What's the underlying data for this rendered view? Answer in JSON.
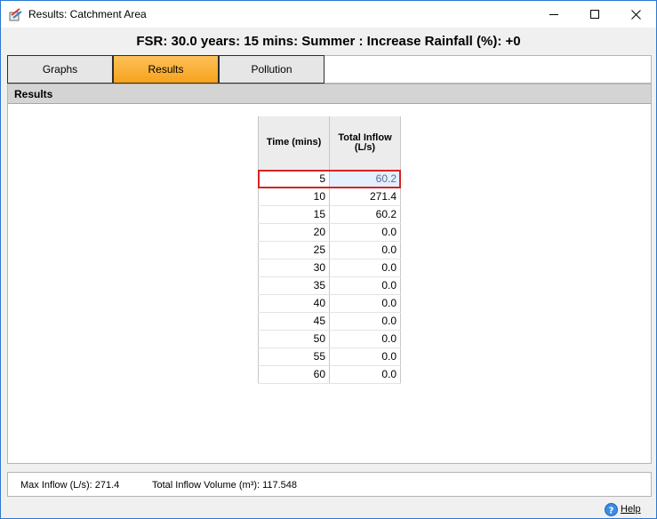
{
  "window": {
    "title": "Results: Catchment Area"
  },
  "headline": "FSR: 30.0 years: 15 mins: Summer : Increase Rainfall (%): +0",
  "tabs": [
    {
      "label": "Graphs",
      "active": false
    },
    {
      "label": "Results",
      "active": true
    },
    {
      "label": "Pollution",
      "active": false
    }
  ],
  "panel": {
    "title": "Results"
  },
  "table": {
    "headers": [
      "Time (mins)",
      "Total Inflow\n(L/s)"
    ],
    "rows": [
      [
        "5",
        "60.2"
      ],
      [
        "10",
        "271.4"
      ],
      [
        "15",
        "60.2"
      ],
      [
        "20",
        "0.0"
      ],
      [
        "25",
        "0.0"
      ],
      [
        "30",
        "0.0"
      ],
      [
        "35",
        "0.0"
      ],
      [
        "40",
        "0.0"
      ],
      [
        "45",
        "0.0"
      ],
      [
        "50",
        "0.0"
      ],
      [
        "55",
        "0.0"
      ],
      [
        "60",
        "0.0"
      ]
    ],
    "selected_row": 0
  },
  "status": {
    "max_inflow": "Max Inflow (L/s): 271.4",
    "total_volume": "Total Inflow Volume (m³): 117.548"
  },
  "help": {
    "label": "Help"
  },
  "colors": {
    "active_tab": "#f7a21b",
    "selection_border": "#d52424",
    "window_border": "#2b79d0"
  },
  "icons": {
    "app": "app-icon",
    "minimize": "minimize-icon",
    "maximize": "maximize-icon",
    "close": "close-icon",
    "help": "help-icon"
  }
}
